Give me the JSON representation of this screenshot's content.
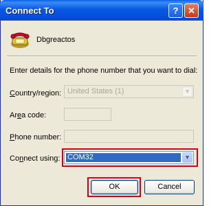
{
  "window": {
    "title": "Connect To"
  },
  "titlebar": {
    "help_glyph": "?",
    "close_glyph": "✕"
  },
  "connection": {
    "name": "Dbgreactos",
    "icon": "phone-icon"
  },
  "instructions": "Enter details for the phone number that you want to dial:",
  "country": {
    "label_pre": "",
    "label_u": "C",
    "label_post": "ountry/region:",
    "value": "United States (1)",
    "enabled": false
  },
  "area": {
    "label_pre": "Ar",
    "label_u": "e",
    "label_post": "a code:",
    "value": ""
  },
  "phone": {
    "label_pre": "",
    "label_u": "P",
    "label_post": "hone number:",
    "value": ""
  },
  "connect": {
    "label_pre": "Co",
    "label_u": "n",
    "label_post": "nect using:",
    "value": "COM32"
  },
  "buttons": {
    "ok": "OK",
    "cancel": "Cancel"
  },
  "highlight_color": "#d4001a"
}
